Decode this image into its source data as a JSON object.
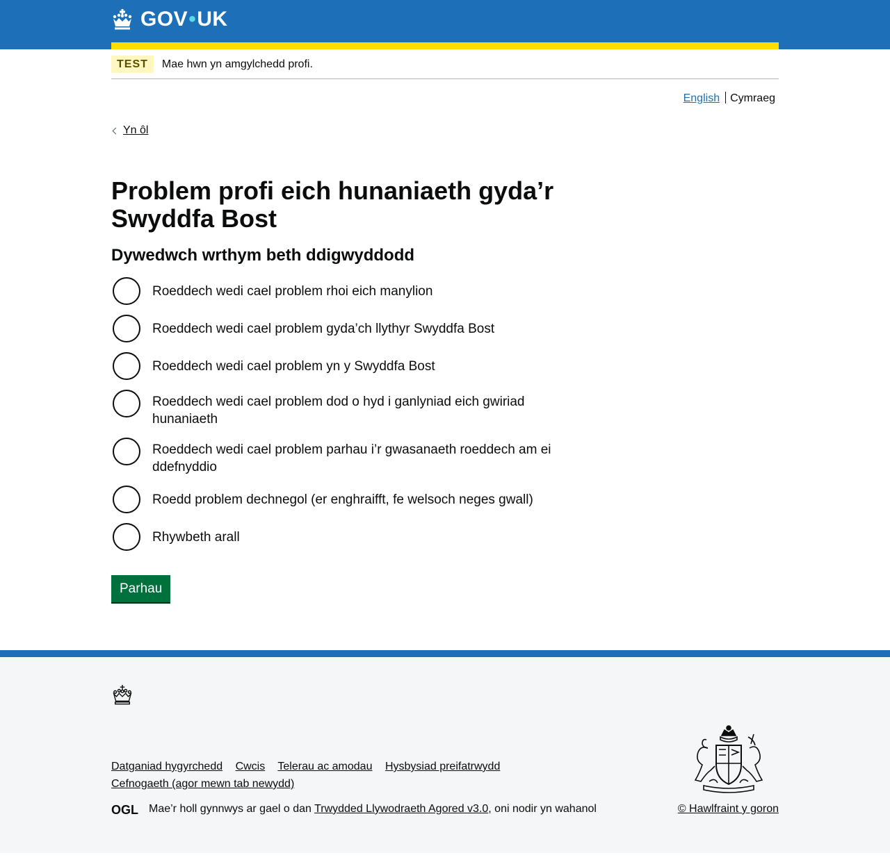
{
  "header": {
    "logo_text": "GOV",
    "logo_text_2": "UK",
    "logo_icon": "crown-icon"
  },
  "phase_banner": {
    "tag": "TEST",
    "text": "Mae hwn yn amgylchedd profi."
  },
  "language": {
    "english": "English",
    "welsh": "Cymraeg"
  },
  "back_link": "Yn ôl",
  "page": {
    "title": "Problem profi eich hunaniaeth gyda’r Swyddfa Bost",
    "legend": "Dywedwch wrthym beth ddigwyddodd",
    "options": [
      "Roeddech wedi cael problem rhoi eich manylion",
      "Roeddech wedi cael problem gyda’ch llythyr Swyddfa Bost",
      "Roeddech wedi cael problem yn y Swyddfa Bost",
      "Roeddech wedi cael problem dod o hyd i ganlyniad eich gwiriad hunaniaeth",
      "Roeddech wedi cael problem parhau i’r gwasanaeth roeddech am ei ddefnyddio",
      "Roedd problem dechnegol (er enghraifft, fe welsoch neges gwall)",
      "Rhywbeth arall"
    ],
    "continue_button": "Parhau"
  },
  "footer": {
    "links": [
      "Datganiad hygyrchedd",
      "Cwcis",
      "Telerau ac amodau",
      "Hysbysiad preifatrwydd",
      "Cefnogaeth (agor mewn tab newydd)"
    ],
    "licence_prefix": "Mae’r holl gynnwys ar gael o dan ",
    "licence_link": "Trwydded Llywodraeth Agored v3.0",
    "licence_suffix": ", oni nodir yn wahanol",
    "ogl_logo": "OGL",
    "copyright": "© Hawlfraint y goron"
  },
  "colors": {
    "header_blue": "#1d70b8",
    "yellow_bar": "#ffdd00",
    "button_green": "#00703c",
    "phase_tag_bg": "#fff7bf"
  }
}
